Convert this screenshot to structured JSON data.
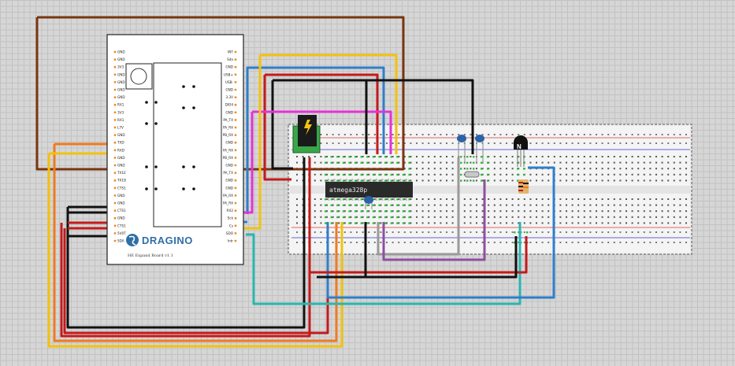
{
  "board": {
    "left_pins": [
      "GND",
      "GND",
      "3V3",
      "GND",
      "GND",
      "GND",
      "GND",
      "RX1",
      "3V3",
      "RX1",
      "L7V",
      "GND",
      "TXD",
      "RXD",
      "GND",
      "GND",
      "TX1E",
      "TX1B",
      "CTS1",
      "GND",
      "GND",
      "CTS1",
      "GND",
      "CTS1",
      "5V0T",
      "SDA"
    ],
    "right_pins": [
      "INT",
      "Sda",
      "GND",
      "USB+",
      "USB-",
      "GND",
      "3.3V",
      "DIO4",
      "GND",
      "PA_TX",
      "PA_RX",
      "PB_RX",
      "GND",
      "PA_RX",
      "PB_RX",
      "GND",
      "PA_TX",
      "GND",
      "GND",
      "PA_RX",
      "PA_RX",
      "RX2",
      "Sck",
      "Cs",
      "SDO",
      "Intr"
    ],
    "logo_text": "DRAGINO",
    "board_name": "HE Expand Board v1.1"
  },
  "chip": {
    "label": "atmega328p"
  },
  "transistor": {
    "label": "N"
  },
  "colors": {
    "brown": "#7a3510",
    "red": "#c41a1a",
    "black": "#111111",
    "blue": "#2f7ecb",
    "yellow": "#f2c20e",
    "orange": "#f07a1f",
    "magenta": "#e631d7",
    "teal": "#28b6b0",
    "gray": "#9a9a9a",
    "purple": "#8e4fa0"
  }
}
